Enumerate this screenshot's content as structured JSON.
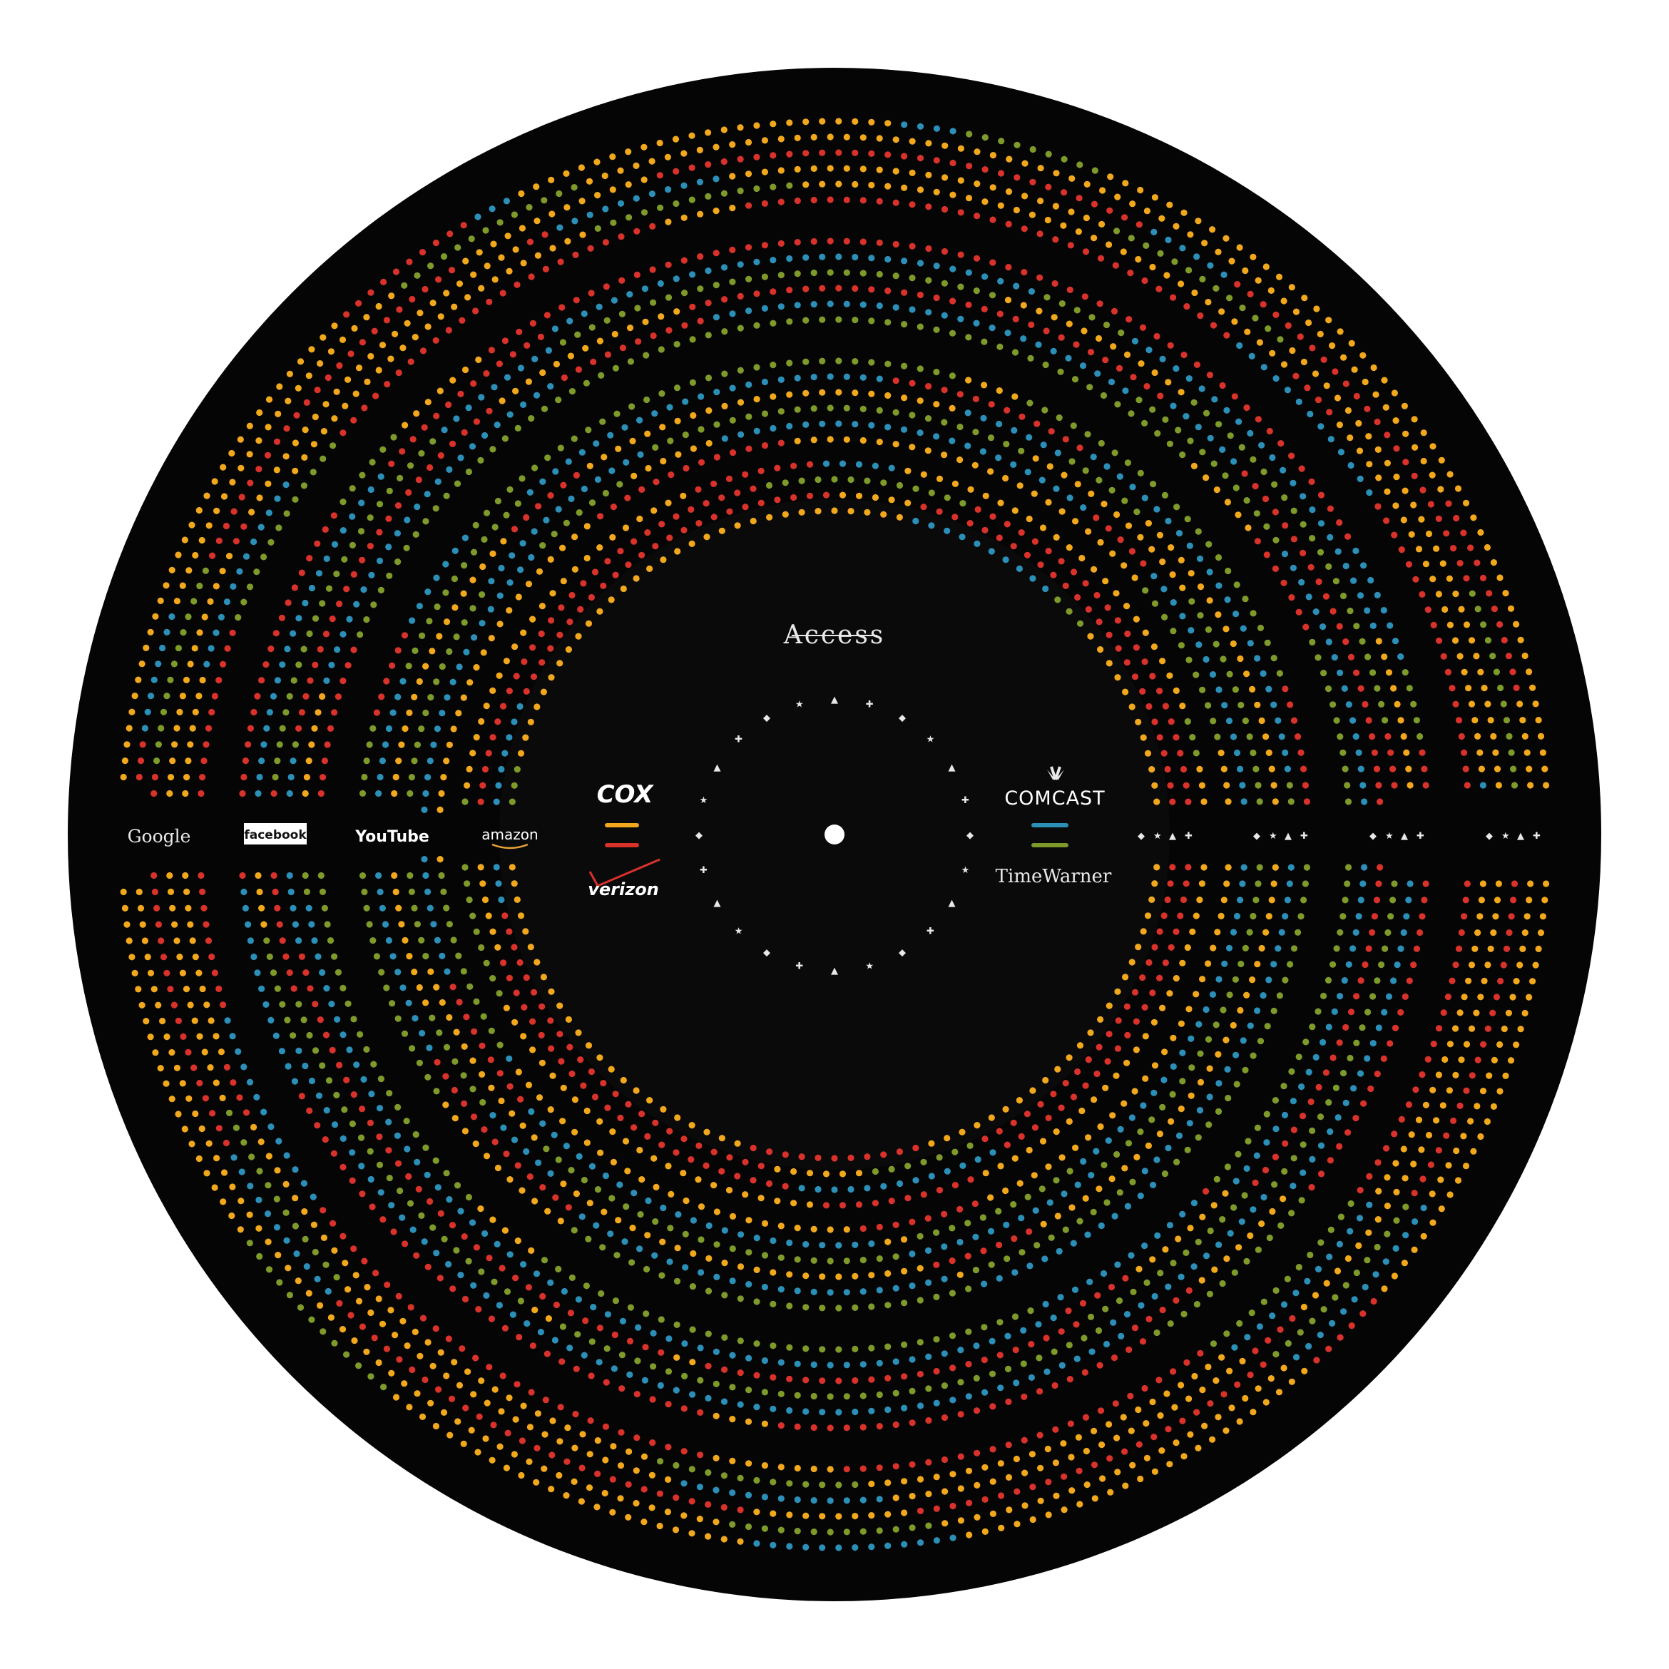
{
  "title": "Access",
  "colors": {
    "disc": "#050505",
    "yellow": "#f2a81d",
    "red": "#d8322b",
    "blue": "#2b8fb8",
    "green": "#7e9a2a",
    "label": "#e8e8e8"
  },
  "content_providers": [
    {
      "name": "Google",
      "icon": "google-logo"
    },
    {
      "name": "facebook",
      "icon": "facebook-logo"
    },
    {
      "name": "YouTube",
      "icon": "youtube-logo"
    },
    {
      "name": "amazon",
      "icon": "amazon-logo"
    }
  ],
  "isps_left": [
    {
      "name": "COX",
      "icon": "cox-logo"
    },
    {
      "name": "verizon",
      "icon": "verizon-logo"
    }
  ],
  "isps_right": [
    {
      "name": "COMCAST",
      "icon": "comcast-peacock-logo"
    },
    {
      "name": "TimeWarner",
      "icon": "timewarner-logo"
    }
  ],
  "rings": [
    {
      "name": "outer",
      "tracks": [
        "yellow",
        "yellow",
        "red"
      ]
    },
    {
      "name": "second",
      "tracks": [
        "red",
        "blue",
        "green"
      ]
    },
    {
      "name": "third",
      "tracks": [
        "green",
        "blue",
        "yellow"
      ]
    },
    {
      "name": "inner",
      "tracks": [
        "yellow",
        "red",
        "red"
      ]
    }
  ],
  "symbol_glyphs": [
    "◆",
    "★",
    "▲",
    "✚"
  ]
}
